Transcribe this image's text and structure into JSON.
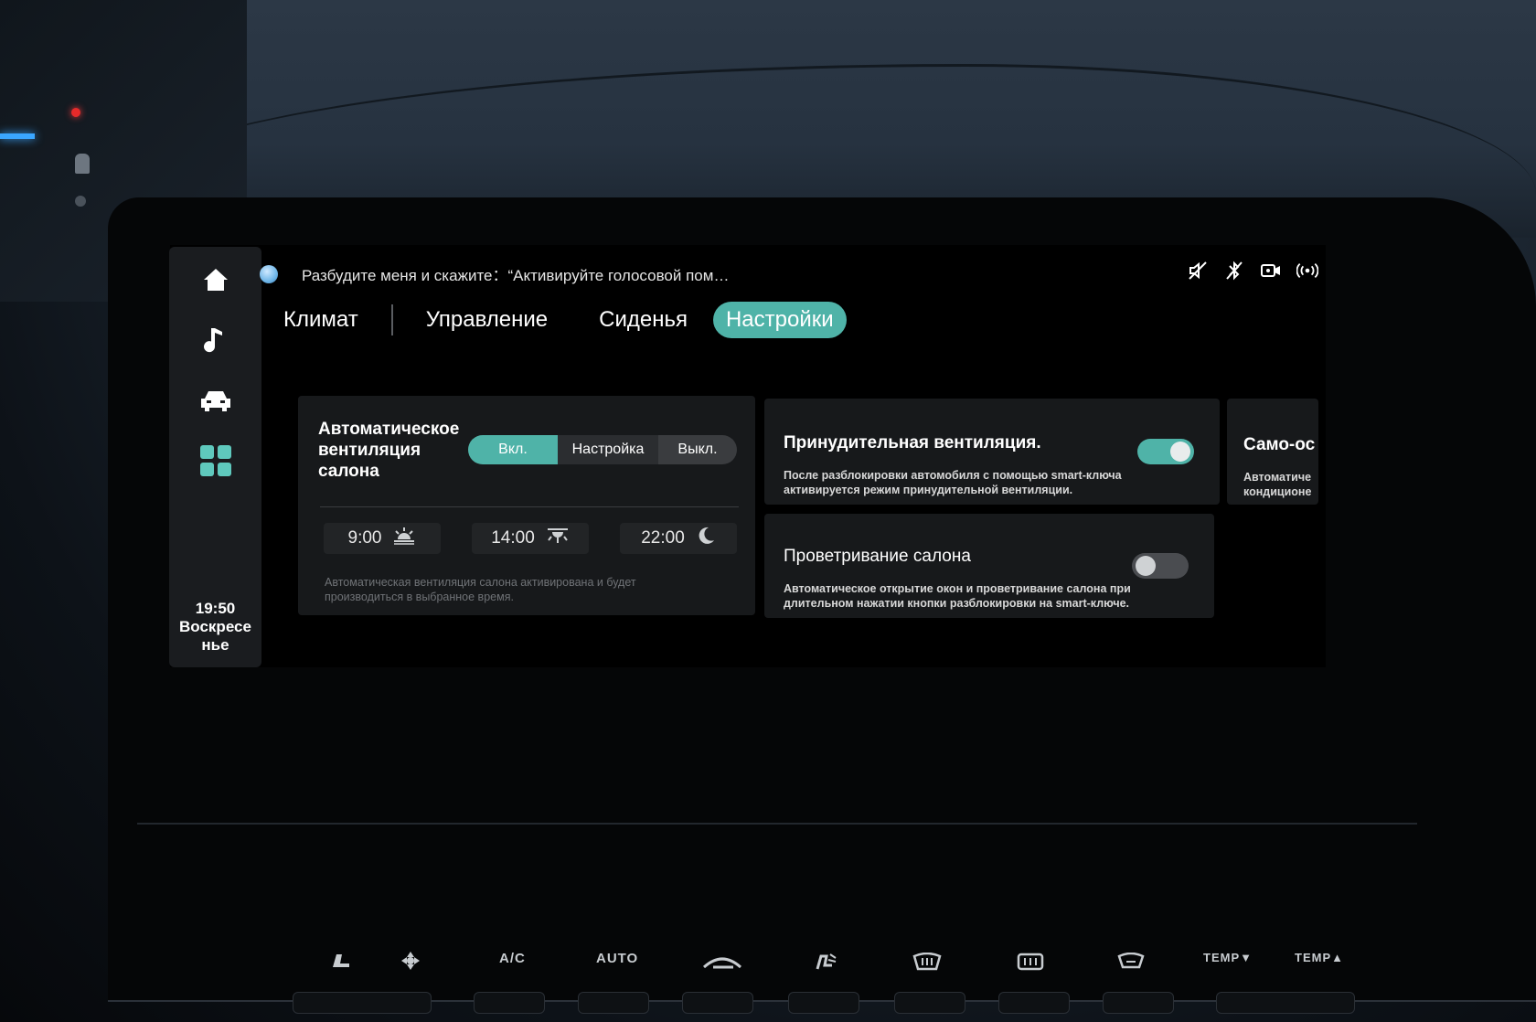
{
  "voice": {
    "text": "Разбудите меня и скажите：“Активируйте голосовой пом…"
  },
  "status_icons": [
    "mute-icon",
    "bluetooth-off-icon",
    "camera-icon",
    "wireless-signal-icon"
  ],
  "sidebar": {
    "items": [
      "home-icon",
      "music-icon",
      "car-icon",
      "apps-icon"
    ],
    "time": "19:50",
    "day_line1": "Воскресе",
    "day_line2": "нье"
  },
  "tabs": [
    {
      "label": "Климат",
      "active": false
    },
    {
      "label": "Управление",
      "active": false
    },
    {
      "label": "Сиденья",
      "active": false
    },
    {
      "label": "Настройки",
      "active": true
    }
  ],
  "auto_vent": {
    "title_line1": "Автоматическое",
    "title_line2": "вентиляция",
    "title_line3": "салона",
    "seg_on": "Вкл.",
    "seg_setup": "Настройка",
    "seg_off": "Выкл.",
    "selected": "Вкл.",
    "times": [
      {
        "time": "9:00",
        "icon": "sunrise-icon"
      },
      {
        "time": "14:00",
        "icon": "sun-overhead-icon"
      },
      {
        "time": "22:00",
        "icon": "moon-icon"
      }
    ],
    "desc_line1": "Автоматическая вентиляция салона активирована и будет",
    "desc_line2": "производиться в выбранное время."
  },
  "forced_vent": {
    "title": "Принудительная вентиляция.",
    "desc_line1": "После разблокировки автомобиля с помощью smart-ключа",
    "desc_line2": "активируется режим принудительной вентиляции.",
    "enabled": true
  },
  "airing": {
    "title": "Проветривание салона",
    "desc_line1": "Автоматическое открытие окон и проветривание салона при",
    "desc_line2": "длительном нажатии кнопки разблокировки на smart-ключе.",
    "enabled": false
  },
  "self_clean": {
    "title": "Само-ос",
    "desc_line1": "Автоматиче",
    "desc_line2": "кондиционе"
  },
  "physical_buttons": [
    "A/C",
    "AUTO",
    "TEMP▼",
    "TEMP▲"
  ],
  "colors": {
    "accent": "#4fb3a8",
    "card": "#17191b",
    "screen": "#000000"
  }
}
